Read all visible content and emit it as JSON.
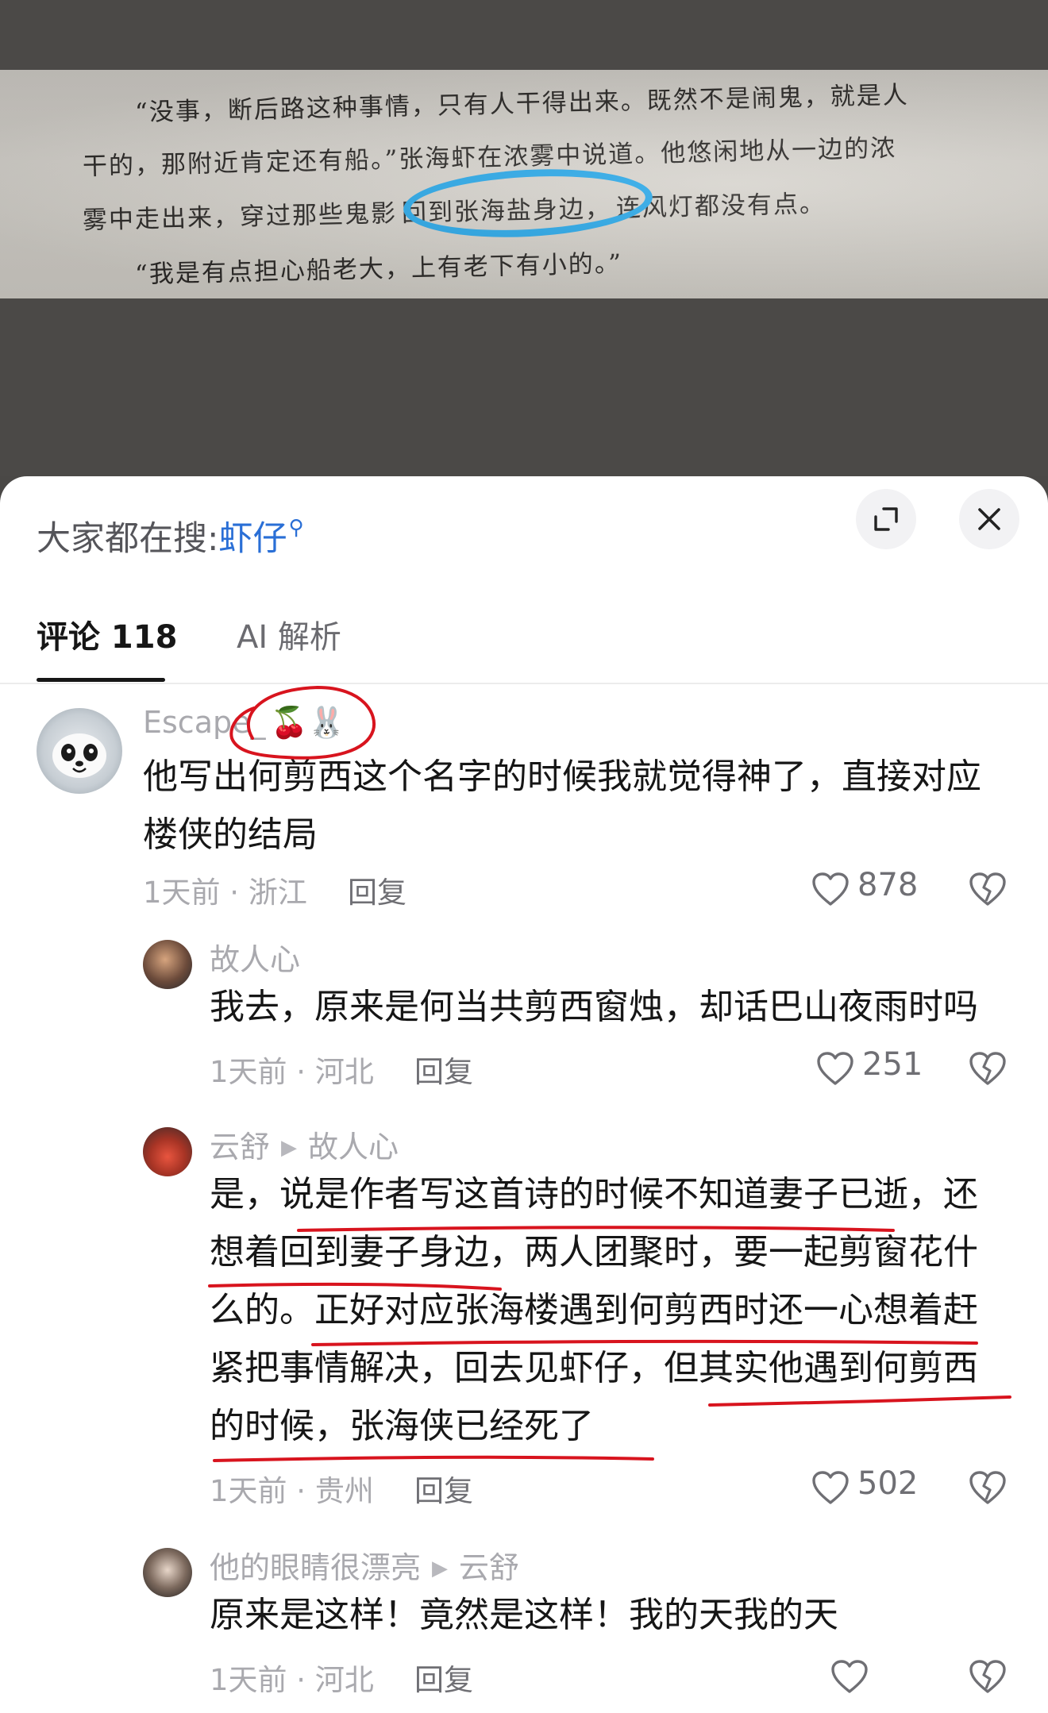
{
  "book_photo": {
    "line1": "“没事，断后路这种事情，只有人干得出来。既然不是闹鬼，就是人",
    "line2": "干的，那附近肯定还有船。”张海虾在浓雾中说道。他悠闲地从一边的浓",
    "line3_before": "雾中走出来，穿过那些鬼影",
    "line3_highlight": "回到张海盐身边，",
    "line3_after": "连风灯都没有点。",
    "line4": "“我是有点担心船老大，上有老下有小的。”"
  },
  "header": {
    "search_prefix": "大家都在搜:",
    "search_keyword": "虾仔",
    "expand_icon": "expand-icon",
    "close_icon": "close-icon"
  },
  "tabs": [
    {
      "label": "评论 118",
      "active": true
    },
    {
      "label": "AI 解析",
      "active": false
    }
  ],
  "comments": [
    {
      "username": "Escape_",
      "emoji": "🍒🐰",
      "text": "他写出何剪西这个名字的时候我就觉得神了，直接对应楼侠的结局",
      "meta": "1天前 · 浙江",
      "reply_label": "回复",
      "likes": "878"
    },
    {
      "username": "故人心",
      "text": "我去，原来是何当共剪西窗烛，却话巴山夜雨时吗",
      "meta": "1天前 · 河北",
      "reply_label": "回复",
      "likes": "251"
    },
    {
      "username": "云舒",
      "reply_to": "故人心",
      "text_lines": [
        "是，说是作者写这首诗的时候不知道妻子已逝，还",
        "想着回到妻子身边，两人团聚时，要一起剪窗花什",
        "么的。正好对应张海楼遇到何剪西时还一心想着赶",
        "紧把事情解决，回去见虾仔，但其实他遇到何剪西",
        "的时候，张海侠已经死了"
      ],
      "meta": "1天前 · 贵州",
      "reply_label": "回复",
      "likes": "502"
    },
    {
      "username": "他的眼睛很漂亮",
      "reply_to": "云舒",
      "text": "原来是这样！竟然是这样！我的天我的天",
      "meta": "1天前 · 河北",
      "reply_label": "回复",
      "likes": ""
    }
  ],
  "colors": {
    "link_blue": "#2a6fd6",
    "highlight_circle": "#2aa8e8",
    "annotation_red": "#d8141e"
  }
}
